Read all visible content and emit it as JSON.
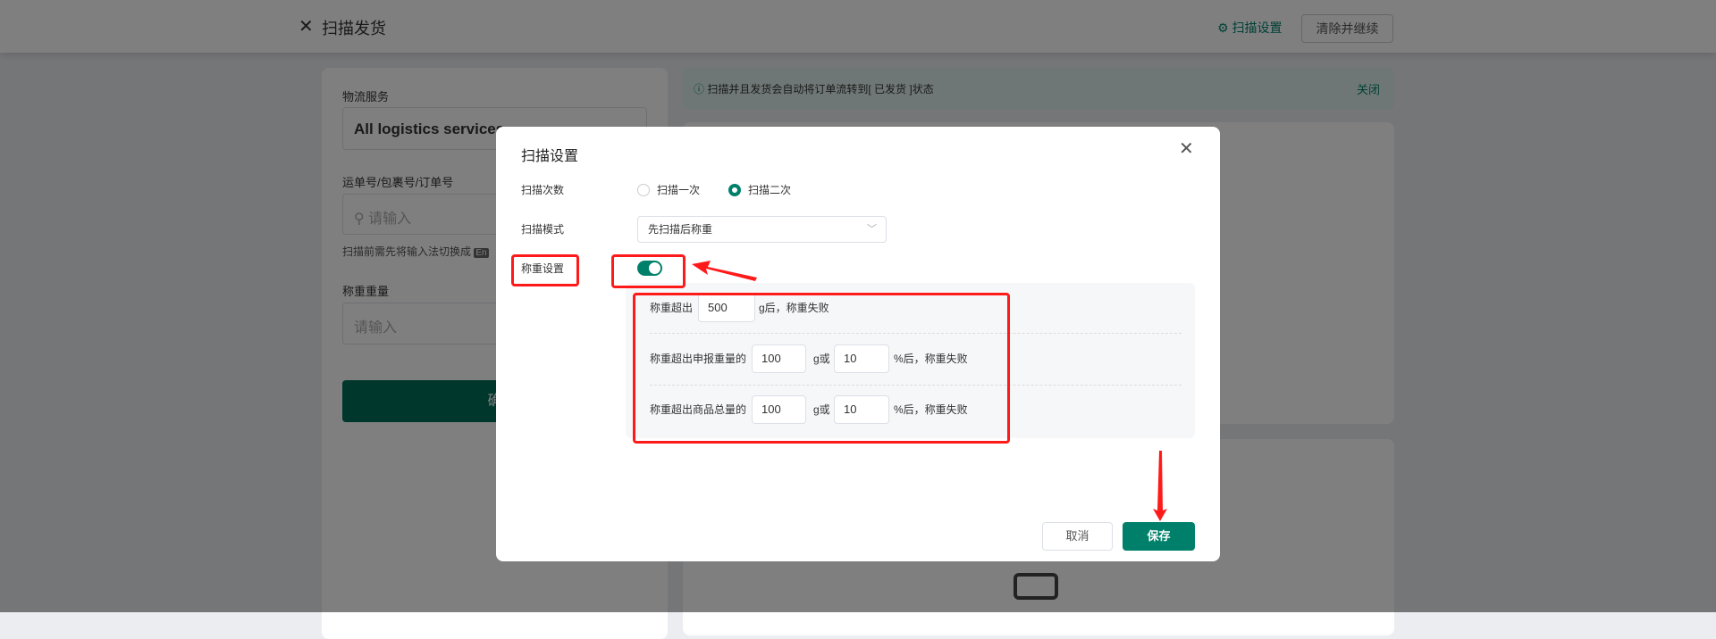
{
  "header": {
    "title": "扫描发货",
    "settings_link": "扫描设置",
    "clear_button": "清除并继续"
  },
  "left": {
    "logistics_label": "物流服务",
    "logistics_value": "All logistics services",
    "tracking_label": "运单号/包裹号/订单号",
    "tracking_placeholder": "请输入",
    "hint": "扫描前需先将输入法切换成",
    "hint_badge": "En",
    "weight_label": "称重重量",
    "weight_placeholder": "请输入",
    "confirm_button": "确"
  },
  "right": {
    "info_text": "扫描并且发货会自动将订单流转到[ 已发货 ]状态",
    "info_close": "关闭"
  },
  "dialog": {
    "title": "扫描设置",
    "scan_count_label": "扫描次数",
    "scan_options": [
      {
        "label": "扫描一次",
        "selected": false
      },
      {
        "label": "扫描二次",
        "selected": true
      }
    ],
    "scan_mode_label": "扫描模式",
    "scan_mode_value": "先扫描后称重",
    "weigh_setting_label": "称重设置",
    "weigh_enabled": true,
    "rule1": {
      "prefix": "称重超出",
      "value": "500",
      "suffix": "g后，称重失败"
    },
    "rule2": {
      "prefix": "称重超出申报重量的",
      "grams": "100",
      "mid": "g或",
      "percent": "10",
      "suffix": "%后，称重失败"
    },
    "rule3": {
      "prefix": "称重超出商品总量的",
      "grams": "100",
      "mid": "g或",
      "percent": "10",
      "suffix": "%后，称重失败"
    },
    "cancel": "取消",
    "save": "保存"
  },
  "colors": {
    "primary": "#00806a",
    "annotation": "#ff1a1a"
  }
}
